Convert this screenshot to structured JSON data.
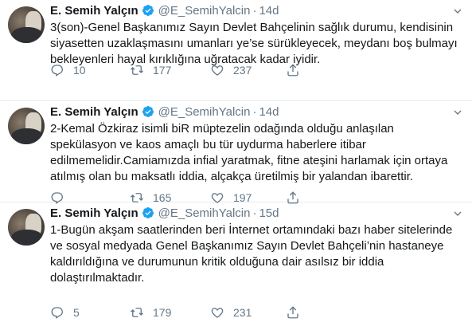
{
  "tweets": [
    {
      "name": "E. Semih Yalçın",
      "handle": "@E_SemihYalcin",
      "time": "14d",
      "lines": [
        "3(son)-Genel Başkanımız Sayın Devlet Bahçelinin sağlık durumu, kendisinin",
        "siyasetten uzaklaşmasını umanları ye’se sürükleyecek, meydanı boş bulmayı",
        "bekleyenleri hayal kırıklığına uğratacak kadar iyidir."
      ],
      "replies": "10",
      "retweets": "177",
      "likes": "237"
    },
    {
      "name": "E. Semih Yalçın",
      "handle": "@E_SemihYalcin",
      "time": "14d",
      "lines": [
        "2-Kemal Özkiraz isimli biR müptezelin odağında olduğu anlaşılan",
        "spekülasyon ve kaos amaçlı bu tür uydurma haberlere itibar",
        "edilmemelidir.Camiamızda infial yaratmak, fitne ateşini harlamak için ortaya",
        "atılmış olan bu maksatlı iddia, alçakça üretilmiş bir yalandan ibarettir."
      ],
      "replies": "",
      "retweets": "165",
      "likes": "197"
    },
    {
      "name": "E. Semih Yalçın",
      "handle": "@E_SemihYalcin",
      "time": "15d",
      "lines": [
        "1-Bugün akşam saatlerinden beri İnternet ortamındaki bazı haber sitelerinde",
        "ve sosyal medyada Genel Başkanımız Sayın Devlet Bahçeli’nin hastaneye",
        "kaldırıldığına ve durumunun kritik olduğuna dair asılsız bir iddia",
        "dolaştırılmaktadır."
      ],
      "replies": "5",
      "retweets": "179",
      "likes": "231"
    }
  ],
  "icons": {
    "verified": "verified-badge-icon",
    "caret": "chevron-down-icon",
    "reply": "reply-icon",
    "retweet": "retweet-icon",
    "like": "heart-icon",
    "share": "share-icon"
  },
  "colors": {
    "text": "#14171a",
    "secondary": "#657786",
    "verified": "#1da1f2",
    "divider": "#e6ecf0"
  }
}
